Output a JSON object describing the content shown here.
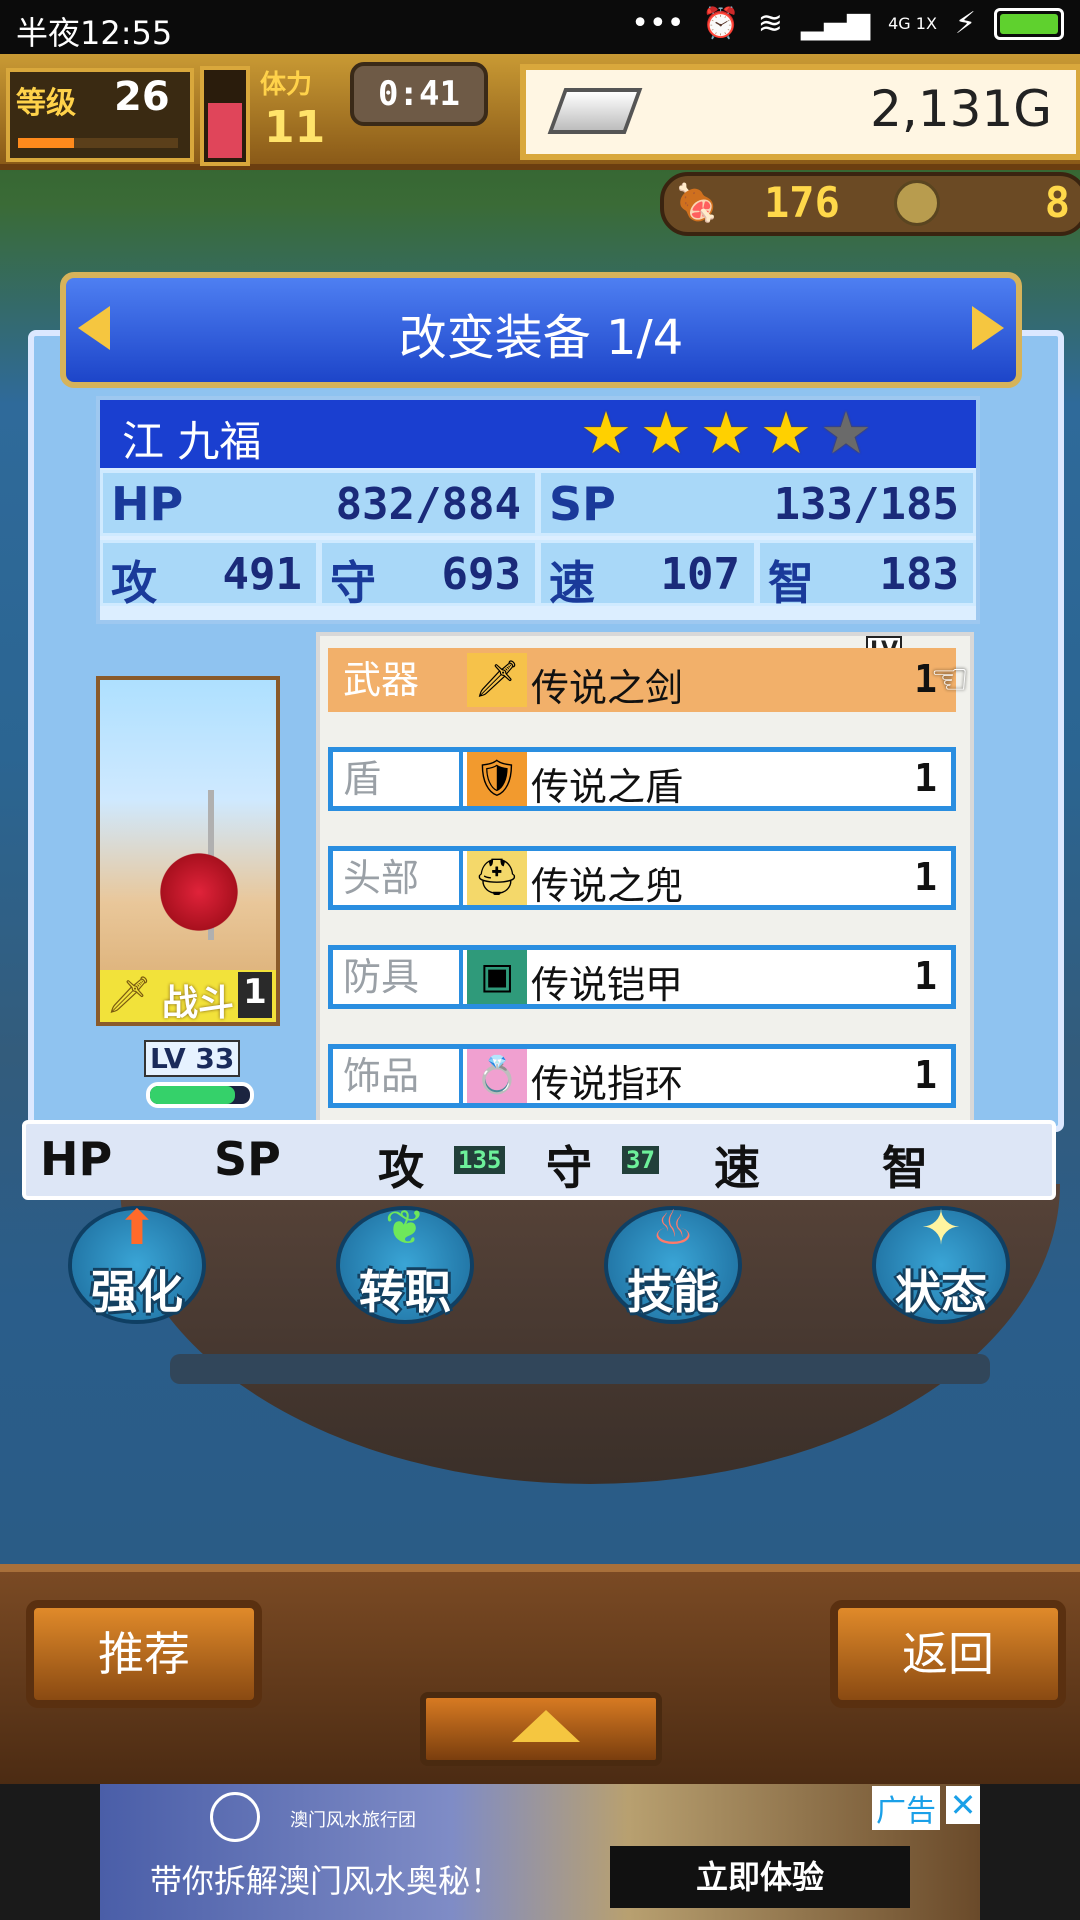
{
  "status_bar": {
    "time": "半夜12:55",
    "icons": [
      "more-dots-icon",
      "alarm-icon",
      "wifi-icon",
      "signal-icon",
      "signal-4g-icon",
      "charging-icon",
      "battery-icon"
    ],
    "network_label": "4G 1X"
  },
  "hud": {
    "level_label": "等级",
    "level": "26",
    "level_progress": 0.35,
    "stamina_label": "体力",
    "stamina": "11",
    "stamina_fill": 0.6,
    "timer": "0:41",
    "gold": "2,131G",
    "meat_count": "176",
    "coin_count": "8"
  },
  "title": {
    "text": "改变装备 1/4",
    "prev_icon": "left-arrow-icon",
    "next_icon": "right-arrow-icon"
  },
  "character": {
    "name": "江 九福",
    "stars_filled": 4,
    "stars_total": 5,
    "hp_label": "HP",
    "hp": "832/884",
    "sp_label": "SP",
    "sp": "133/185",
    "stats": [
      {
        "label": "攻",
        "value": "491"
      },
      {
        "label": "守",
        "value": "693"
      },
      {
        "label": "速",
        "value": "107"
      },
      {
        "label": "智",
        "value": "183"
      }
    ],
    "class_label": "战斗",
    "class_rank": "1",
    "level_tag": "LV 33",
    "exp_fill": 0.85
  },
  "equipment": {
    "lv_header": "LV",
    "slots": [
      {
        "type": "武器",
        "name": "传说之剑",
        "lv": "1",
        "icon": "sword-icon",
        "selected": true
      },
      {
        "type": "盾",
        "name": "传说之盾",
        "lv": "1",
        "icon": "shield-icon",
        "selected": false
      },
      {
        "type": "头部",
        "name": "传说之兜",
        "lv": "1",
        "icon": "helmet-icon",
        "selected": false
      },
      {
        "type": "防具",
        "name": "传说铠甲",
        "lv": "1",
        "icon": "armor-icon",
        "selected": false
      },
      {
        "type": "饰品",
        "name": "传说指环",
        "lv": "1",
        "icon": "ring-icon",
        "selected": false
      }
    ]
  },
  "diff": {
    "hp": "HP",
    "sp": "SP",
    "atk": "攻",
    "atk_val": "135",
    "def": "守",
    "def_val": "37",
    "spd": "速",
    "int": "智"
  },
  "actions": [
    {
      "label": "强化",
      "icon": "arrow-up-icon"
    },
    {
      "label": "转职",
      "icon": "leaf-icon"
    },
    {
      "label": "技能",
      "icon": "flame-icon"
    },
    {
      "label": "状态",
      "icon": "sparkle-icon"
    }
  ],
  "bottom": {
    "recommend": "推荐",
    "back": "返回"
  },
  "ad": {
    "agency": "澳门风水旅行团",
    "headline": "带你拆解澳门风水奥秘！",
    "cta": "立即体验",
    "label": "广告",
    "close": "✕"
  },
  "colors": {
    "panel": "#8fc3f0",
    "title": "#1d45c9",
    "selected_row": "#f2b06a",
    "slot_border": "#2a8ee0"
  }
}
